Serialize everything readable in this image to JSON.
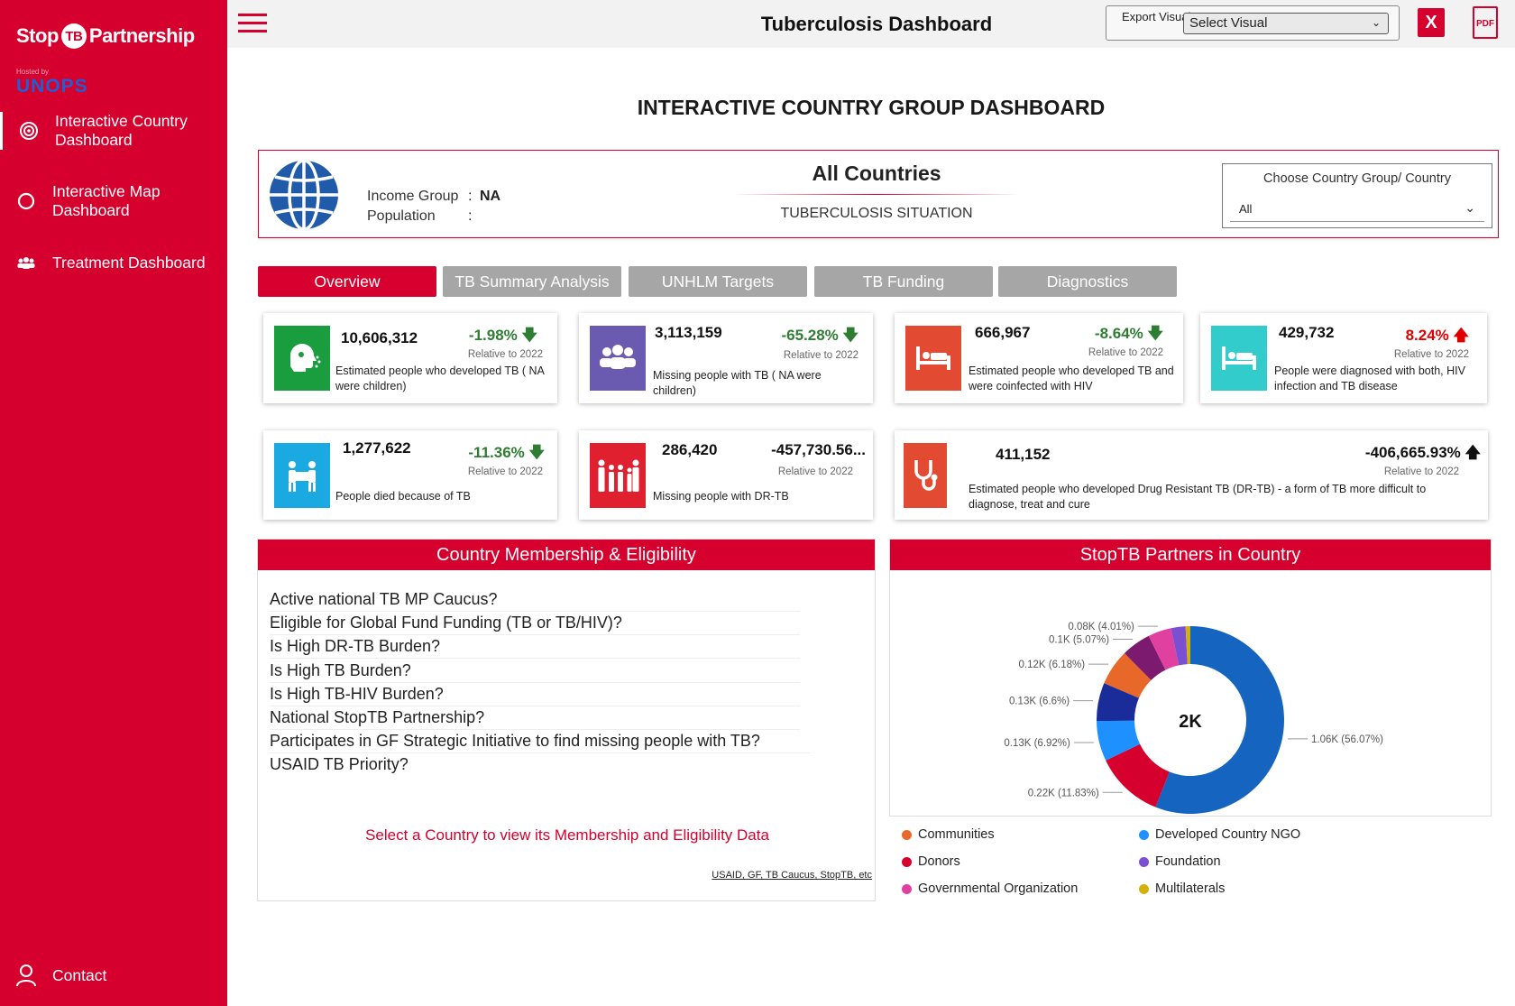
{
  "sidebar": {
    "logo_text_a": "Stop",
    "logo_text_tb": "TB",
    "logo_text_b": "Partnership",
    "hosted_by": "Hosted by",
    "unops": "UNOPS",
    "nav": [
      {
        "label": "Interactive Country Dashboard",
        "icon": "target-icon"
      },
      {
        "label": "Interactive Map Dashboard",
        "icon": "map-pin-icon"
      },
      {
        "label": "Treatment Dashboard",
        "icon": "people-icon"
      }
    ],
    "contact": "Contact"
  },
  "topbar": {
    "title": "Tuberculosis Dashboard",
    "export_label": "Export Visuals:",
    "export_select": "Select Visual",
    "excel_icon": "X",
    "pdf_icon": "PDF"
  },
  "page_title": "INTERACTIVE COUNTRY GROUP DASHBOARD",
  "info": {
    "income_label": "Income Group",
    "income_value": "NA",
    "population_label": "Population",
    "population_value": "",
    "country_title": "All Countries",
    "situation": "TUBERCULOSIS SITUATION",
    "choose_title": "Choose Country Group/ Country",
    "choose_value": "All"
  },
  "tabs": [
    "Overview",
    "TB Summary Analysis",
    "UNHLM Targets",
    "TB Funding",
    "Diagnostics"
  ],
  "cards": [
    {
      "num": "10,606,312",
      "pct": "-1.98%",
      "rel": "Relative to 2022",
      "desc": "Estimated people who developed TB ( NA were children)",
      "color": "#1a9d3f",
      "icon": "cough-icon",
      "dir": "down"
    },
    {
      "num": "3,113,159",
      "pct": "-65.28%",
      "rel": "Relative to 2022",
      "desc": "Missing people with TB ( NA were children)",
      "color": "#6a5bb0",
      "icon": "group-icon",
      "dir": "down"
    },
    {
      "num": "666,967",
      "pct": "-8.64%",
      "rel": "Relative to 2022",
      "desc": "Estimated people who developed TB and were coinfected with HIV",
      "color": "#e24a32",
      "icon": "bed-icon",
      "dir": "down"
    },
    {
      "num": "429,732",
      "pct": "8.24%",
      "rel": "Relative to 2022",
      "desc": "People were diagnosed with both, HIV infection and TB disease",
      "color": "#33cccc",
      "icon": "bed-icon",
      "dir": "up"
    },
    {
      "num": "1,277,622",
      "pct": "-11.36%",
      "rel": "Relative to 2022",
      "desc": "People died because of TB",
      "color": "#1ba9e1",
      "icon": "coffin-bearers-icon",
      "dir": "down"
    },
    {
      "num": "286,420",
      "pct": "-457,730.56...",
      "rel": "Relative to 2022",
      "desc": "Missing people with DR-TB",
      "color": "#e01f2f",
      "icon": "family-icon",
      "dir": "none"
    },
    {
      "num": "411,152",
      "pct": "-406,665.93%",
      "rel": "Relative to 2022",
      "desc": "Estimated people who developed Drug Resistant TB (DR-TB) - a form of TB more difficult to diagnose, treat and cure",
      "color": "#e24a32",
      "icon": "stethoscope-icon",
      "dir": "up-black"
    }
  ],
  "membership": {
    "title": "Country Membership & Eligibility",
    "questions": [
      "Active national TB MP Caucus?",
      "Eligible for Global Fund Funding (TB or TB/HIV)?",
      "Is High DR-TB Burden?",
      "Is High TB Burden?",
      "Is High TB-HIV Burden?",
      "National StopTB Partnership?",
      "Participates in GF Strategic Initiative to find missing people with TB?",
      "USAID TB Priority?"
    ],
    "select_msg": "Select a Country to view its Membership and Eligibility Data",
    "sources": "USAID, GF, TB Caucus, StopTB, etc"
  },
  "partners": {
    "title": "StopTB Partners in Country",
    "center": "2K"
  },
  "chart_data": {
    "type": "pie",
    "subtype": "donut",
    "center_label": "2K",
    "slices": [
      {
        "label": "1.06K (56.07%)",
        "value": 56.07,
        "color": "#1565c0"
      },
      {
        "label": "0.22K (11.83%)",
        "value": 11.83,
        "color": "#d5002d"
      },
      {
        "label": "0.13K (6.92%)",
        "value": 6.92,
        "color": "#1e90ff"
      },
      {
        "label": "0.13K (6.6%)",
        "value": 6.6,
        "color": "#1a2c9a"
      },
      {
        "label": "0.12K (6.18%)",
        "value": 6.18,
        "color": "#e8682a"
      },
      {
        "label": "0.1K (5.07%)",
        "value": 5.07,
        "color": "#7b1a6e"
      },
      {
        "label": "0.08K (4.01%)",
        "value": 4.01,
        "color": "#e040a0"
      },
      {
        "label": "",
        "value": 2.5,
        "color": "#7a4fd0"
      },
      {
        "label": "",
        "value": 0.82,
        "color": "#d4b10a"
      }
    ],
    "legend": [
      {
        "name": "Communities",
        "color": "#e8682a"
      },
      {
        "name": "Developed Country NGO",
        "color": "#1e90ff"
      },
      {
        "name": "Donors",
        "color": "#d5002d"
      },
      {
        "name": "Foundation",
        "color": "#7a4fd0"
      },
      {
        "name": "Governmental Organization",
        "color": "#e040a0"
      },
      {
        "name": "Multilaterals",
        "color": "#d4b10a"
      }
    ]
  }
}
